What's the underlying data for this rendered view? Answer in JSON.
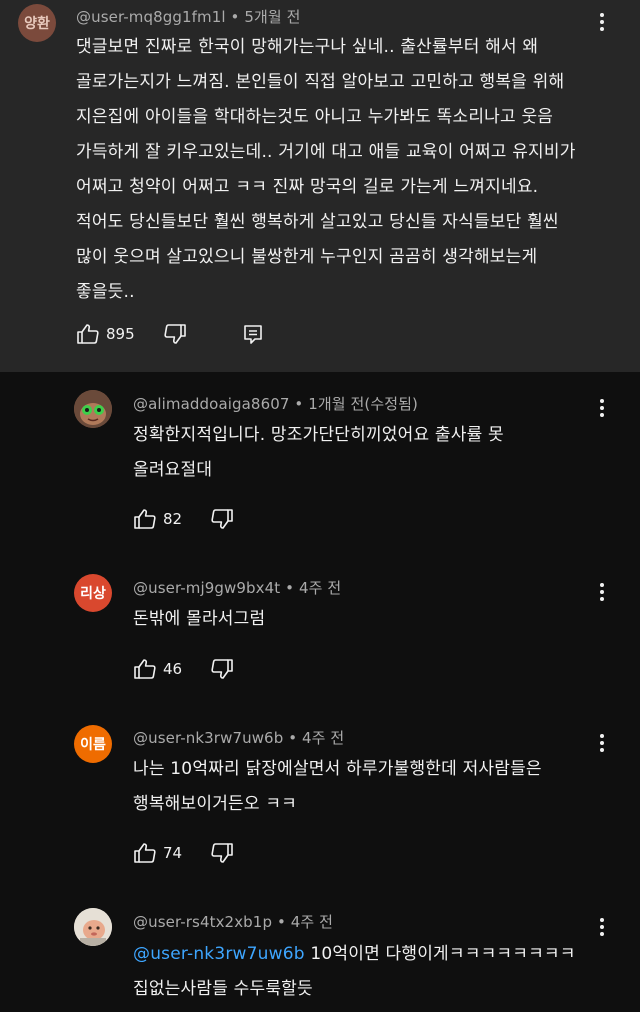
{
  "colors": {
    "background": "#0f0f0f",
    "highlight_background": "#272727",
    "meta_text": "#aaaaaa",
    "mention": "#3ea6ff",
    "avatar_yanghwan": "#7b4a3c",
    "avatar_risang": "#d9482e",
    "avatar_ireum": "#ef6c00"
  },
  "comments": [
    {
      "avatar_text": "양환",
      "handle": "@user-mq8gg1fm1l",
      "time": "• 5개월 전",
      "text": "댓글보면 진짜로 한국이  망해가는구나 싶네.. 출산률부터 해서 왜\n골로가는지가 느껴짐. 본인들이 직접 알아보고 고민하고 행복을 위해\n지은집에 아이들을 학대하는것도 아니고 누가봐도 똑소리나고 웃음\n가득하게 잘 키우고있는데.. 거기에 대고 애들 교육이 어쩌고 유지비가\n어쩌고 청약이 어쩌고 ㅋㅋ 진짜 망국의 길로 가는게 느껴지네요.\n적어도 당신들보단 훨씬 행복하게 살고있고 당신들 자식들보단 훨씬\n많이 웃으며 살고있으니 불쌍한게 누구인지 곰곰히 생각해보는게\n좋을듯..",
      "likes": "895"
    },
    {
      "avatar_icon": "cartoon-avatar",
      "handle": "@alimaddoaiga8607",
      "time": "• 1개월 전(수정됨)",
      "text": "정확한지적입니다. 망조가단단히끼었어요 출사률 못\n올려요절대",
      "likes": "82"
    },
    {
      "avatar_text": "리상",
      "handle": "@user-mj9gw9bx4t",
      "time": "• 4주 전",
      "text": "돈밖에 몰라서그럼",
      "likes": "46"
    },
    {
      "avatar_text": "이름",
      "handle": "@user-nk3rw7uw6b",
      "time": "• 4주 전",
      "text": "나는 10억짜리 닭장에살면서 하루가불행한데 저사람들은\n행복해보이거든오 ㅋㅋ",
      "likes": "74"
    },
    {
      "avatar_icon": "cartoon-avatar",
      "handle": "@user-rs4tx2xb1p",
      "time": "• 4주 전",
      "mention": "@user-nk3rw7uw6b",
      "text": " 10억이면 다행이게ㅋㅋㅋㅋㅋㅋㅋㅋ\n집없는사람들 수두룩할듯"
    }
  ]
}
